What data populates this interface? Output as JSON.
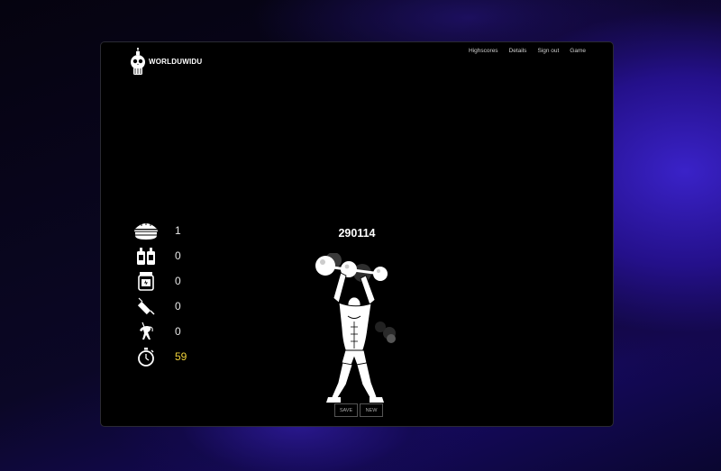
{
  "app": {
    "logo_text": "WORLDUWIDU",
    "logo_icon": "skull-icon"
  },
  "nav": {
    "items": [
      {
        "label": "Highscores"
      },
      {
        "label": "Details"
      },
      {
        "label": "Sign out"
      },
      {
        "label": "Game"
      }
    ]
  },
  "stats": [
    {
      "icon": "burger-icon",
      "value": "1"
    },
    {
      "icon": "jugs-icon",
      "value": "0"
    },
    {
      "icon": "supplement-jar-icon",
      "value": "0"
    },
    {
      "icon": "syringe-icon",
      "value": "0"
    },
    {
      "icon": "unicorn-icon",
      "value": "0"
    },
    {
      "icon": "stopwatch-icon",
      "value": "59"
    }
  ],
  "game": {
    "score": "290114"
  },
  "buttons": {
    "save_label": "SAVE",
    "new_label": "NEW"
  },
  "colors": {
    "timer": "#f0d23a",
    "background": "#000000",
    "accent_glow": "#3a22c8"
  }
}
